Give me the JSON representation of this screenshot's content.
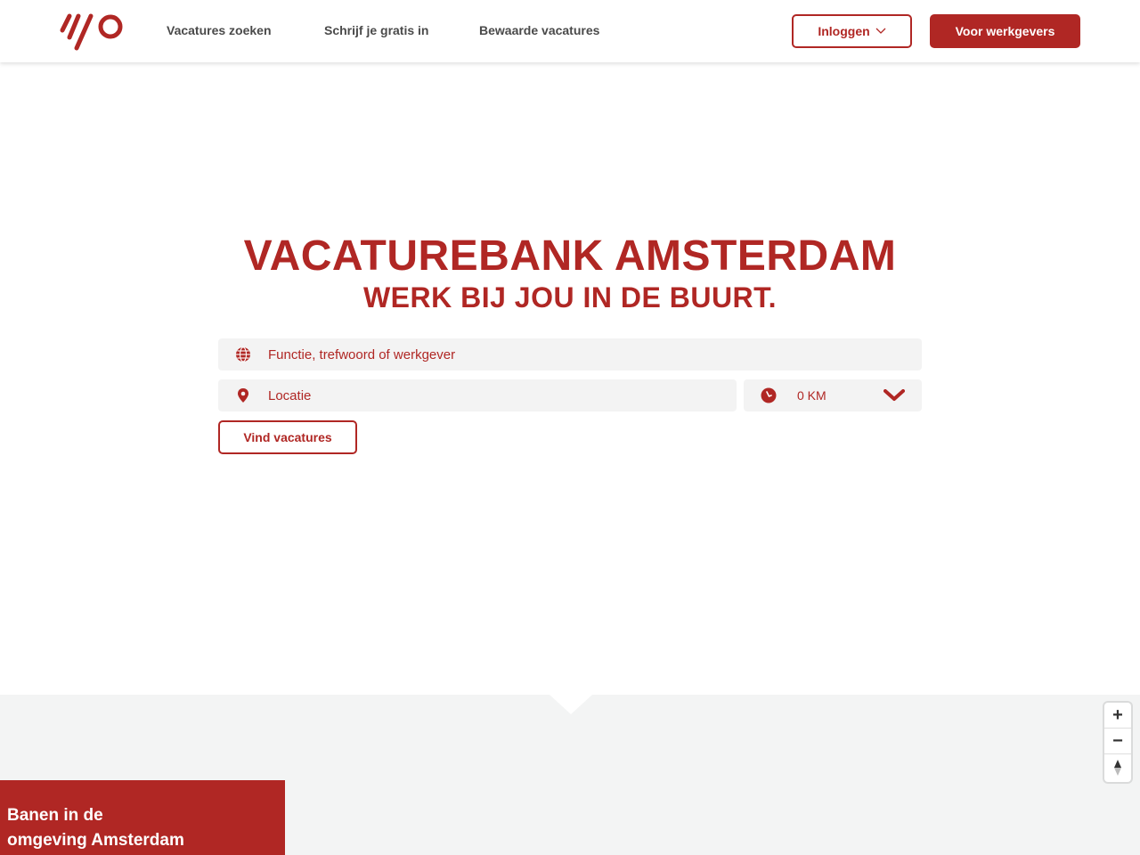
{
  "header": {
    "logo_name": "yo-logo",
    "nav": [
      {
        "label": "Vacatures zoeken"
      },
      {
        "label": "Schrijf je gratis in"
      },
      {
        "label": "Bewaarde vacatures"
      }
    ],
    "login_label": "Inloggen",
    "employer_label": "Voor werkgevers"
  },
  "hero": {
    "title": "VACATUREBANK AMSTERDAM",
    "subtitle": "WERK BIJ JOU IN DE BUURT."
  },
  "search": {
    "keyword_placeholder": "Functie, trefwoord of werkgever",
    "location_placeholder": "Locatie",
    "radius_value": "0 KM",
    "submit_label": "Vind vacatures"
  },
  "map": {
    "zoom_in_label": "+",
    "zoom_out_label": "−",
    "panel_title_line1": "Banen in de",
    "panel_title_line2": "omgeving Amsterdam"
  },
  "colors": {
    "brand": "#b02724",
    "field_bg": "#f3f3f3",
    "map_bg": "#f3f4f4"
  }
}
